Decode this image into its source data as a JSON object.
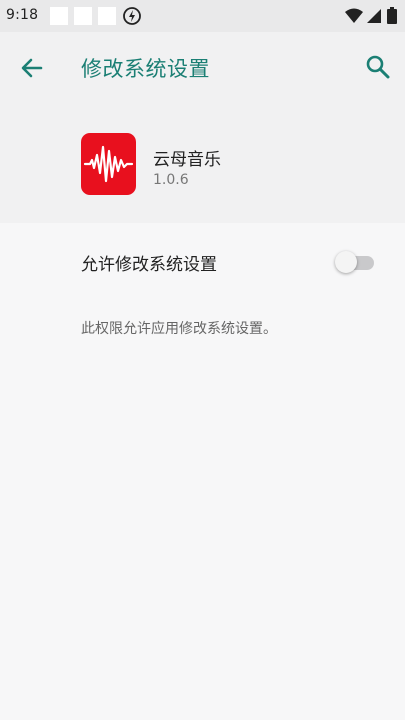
{
  "status_bar": {
    "time": "9:18",
    "icons": [
      "notification-box-icon",
      "notification-box-icon",
      "notification-box-icon",
      "charging-icon",
      "wifi-icon",
      "signal-icon",
      "battery-icon"
    ]
  },
  "app_bar": {
    "title": "修改系统设置",
    "back_icon": "arrow-back-icon",
    "search_icon": "search-icon"
  },
  "app_info": {
    "name": "云母音乐",
    "version": "1.0.6",
    "icon": "waveform-icon",
    "icon_color": "#e8101e"
  },
  "permission": {
    "label": "允许修改系统设置",
    "enabled": false,
    "description": "此权限允许应用修改系统设置。"
  },
  "colors": {
    "accent": "#1b7f74",
    "background": "#f7f7f8",
    "header_background": "#f1f1f2"
  }
}
